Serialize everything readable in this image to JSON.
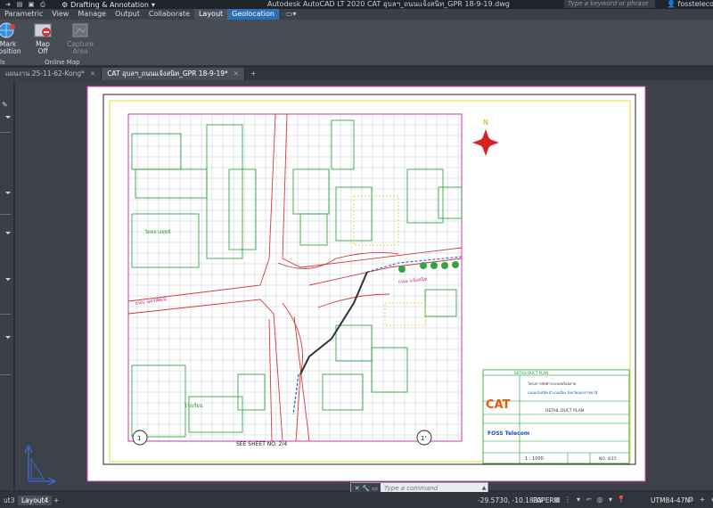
{
  "titlebar": {
    "workspace": "Drafting & Annotation",
    "app_title": "Autodesk AutoCAD LT 2020    CAT อุบลฯ_ถนนแจ้งสนิท_GPR 18-9-19.dwg",
    "search_placeholder": "Type a keyword or phrase",
    "user": "fosstelecom-..."
  },
  "ribbon": {
    "tabs": [
      "Parametric",
      "View",
      "Manage",
      "Output",
      "Collaborate",
      "Layout",
      "Geolocation"
    ],
    "active_tab": "Geolocation",
    "buttons": {
      "mark_position": "Mark\nPosition",
      "map_off": "Map Off",
      "capture_area": "Capture\nArea"
    },
    "panels": {
      "tools": "ls",
      "online_map": "Online Map"
    }
  },
  "doc_tabs": [
    {
      "label": "แผนงาน 25-11-62-Kong*",
      "active": false
    },
    {
      "label": "CAT อุบลฯ_ถนนแจ้งสนิท_GPR 18-9-19*",
      "active": true
    }
  ],
  "drawing": {
    "north": "N",
    "road_label_1": "ถนน นครพัฒน์",
    "road_label_2": "ถนน แจ้งสนิท",
    "temple_label": "วัดหลวงสุทธิ",
    "school_label": "โรงเรียน",
    "see_sheet": "SEE SHEET NO. 2/4",
    "marker_left": "1",
    "marker_right": "1'",
    "titleblock": {
      "header": "DETAIL DUCT PLAN",
      "brand": "CAT",
      "project_line1": "โครงการจัดทำระบบท่อร้อยสาย",
      "project_line2": "ถนนแจ้งสนิท อำเภอเมือง จังหวัดอุบลราชธานี",
      "detail": "DETAIL DUCT PLAN",
      "company": "FOSS Telecom",
      "scale": "1 : 1000",
      "sheet": "NO. 4/15"
    }
  },
  "statusbar": {
    "layouts": [
      "ut3",
      "Layout4"
    ],
    "coords": "-29.5730, -10.1833",
    "space": "PAPER",
    "utm": "UTM84-47N"
  },
  "command": {
    "placeholder": "Type a command"
  }
}
